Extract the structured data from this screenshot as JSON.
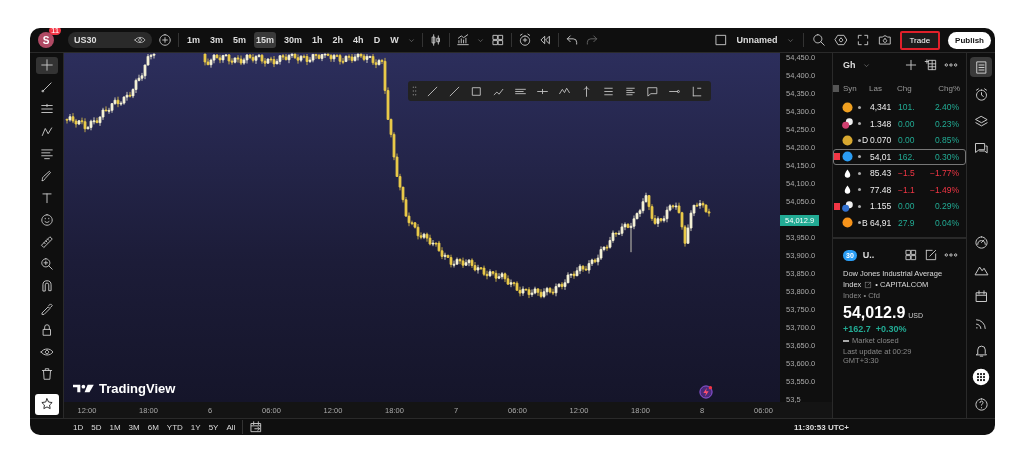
{
  "top_bar": {
    "avatar_letter": "S",
    "notification_count": "11",
    "symbol": "US30",
    "intervals": [
      {
        "label": "1m",
        "selected": false
      },
      {
        "label": "3m",
        "selected": false
      },
      {
        "label": "5m",
        "selected": false
      },
      {
        "label": "15m",
        "selected": true
      },
      {
        "label": "30m",
        "selected": false
      },
      {
        "label": "1h",
        "selected": false
      },
      {
        "label": "2h",
        "selected": false
      },
      {
        "label": "4h",
        "selected": false
      },
      {
        "label": "D",
        "selected": false
      },
      {
        "label": "W",
        "selected": false
      }
    ],
    "layout_name": "Unnamed",
    "trade_button": {
      "label": "Trade",
      "highlighted": true
    },
    "publish_button": "Publish"
  },
  "left_tools": [
    {
      "kind": "crosshair",
      "selected": true
    },
    {
      "kind": "trendline",
      "selected": false
    },
    {
      "kind": "fib",
      "selected": false
    },
    {
      "kind": "pattern",
      "selected": false
    },
    {
      "kind": "forecast",
      "selected": false
    },
    {
      "kind": "brush",
      "selected": false
    },
    {
      "kind": "text",
      "selected": false
    },
    {
      "kind": "emoji",
      "selected": false
    },
    {
      "kind": "ruler",
      "selected": false
    },
    {
      "kind": "zoom",
      "selected": false
    },
    {
      "kind": "magnet",
      "selected": false
    },
    {
      "kind": "lockpen",
      "selected": false
    },
    {
      "kind": "lock",
      "selected": false
    },
    {
      "kind": "eye",
      "selected": false
    },
    {
      "kind": "trash",
      "selected": false
    },
    {
      "kind": "star",
      "selected": false
    }
  ],
  "chart": {
    "logo": "TradingView",
    "current_price": "54,012.9",
    "price_labels_above": [
      "54,450.0",
      "54,400.0",
      "54,350.0",
      "54,300.0",
      "54,250.0",
      "54,200.0",
      "54,150.0",
      "54,100.0",
      "54,050.0"
    ],
    "price_labels_below": [
      "53,950.0",
      "53,900.0",
      "53,850.0",
      "53,800.0",
      "53,750.0",
      "53,700.0",
      "53,650.0",
      "53,600.0",
      "53,550.0",
      "53,5"
    ],
    "time_labels": [
      "12:00",
      "18:00",
      "6",
      "06:00",
      "12:00",
      "18:00",
      "7",
      "06:00",
      "12:00",
      "18:00",
      "8",
      "06:00"
    ]
  },
  "bottom_bar": {
    "ranges": [
      "1D",
      "5D",
      "1M",
      "3M",
      "6M",
      "YTD",
      "1Y",
      "5Y",
      "All"
    ],
    "clock": "11:30:53 UTC+"
  },
  "watchlist": {
    "name": "Gh",
    "columns": [
      "Syn",
      "Las",
      "Chg",
      "Chg%"
    ],
    "rows": [
      {
        "kind": "coin",
        "color": "#f0a020",
        "last": "4,341",
        "change": "101.",
        "change_pct": "2.40%",
        "rising": true,
        "flagged": false,
        "selected": false
      },
      {
        "kind": "pair",
        "color": "#d04070",
        "last": "1.348",
        "change": "0.00",
        "change_pct": "0.23%",
        "rising": true,
        "flagged": false,
        "selected": false
      },
      {
        "kind": "coin",
        "color": "#d8a830",
        "symbol": "D",
        "last": "0.070",
        "change": "0.00",
        "change_pct": "0.85%",
        "rising": true,
        "flagged": false,
        "selected": false
      },
      {
        "kind": "coin",
        "color": "#2a9df4",
        "last": "54,01",
        "change": "162.",
        "change_pct": "0.30%",
        "rising": true,
        "flagged": true,
        "selected": true
      },
      {
        "kind": "drop",
        "color": "#ffffff",
        "last": "85.43",
        "change": "−1.5",
        "change_pct": "−1.77%",
        "rising": false,
        "flagged": false,
        "selected": false
      },
      {
        "kind": "drop",
        "color": "#ffffff",
        "last": "77.48",
        "change": "−1.1",
        "change_pct": "−1.49%",
        "rising": false,
        "flagged": false,
        "selected": false
      },
      {
        "kind": "pair",
        "color": "#3070d0",
        "last": "1.155",
        "change": "0.00",
        "change_pct": "0.29%",
        "rising": true,
        "flagged": true,
        "selected": false
      },
      {
        "kind": "coin",
        "color": "#f7931a",
        "symbol": "B",
        "last": "64,91",
        "change": "27.9",
        "change_pct": "0.04%",
        "rising": true,
        "flagged": false,
        "selected": false
      }
    ]
  },
  "details": {
    "badge": "30",
    "symbol": "U..",
    "name": "Dow Jones Industrial Average",
    "type": "Index",
    "exchange": "• CAPITALCOM",
    "category": "Index • Cfd",
    "price": "54,012.9",
    "currency": "USD",
    "change": "+162.7",
    "change_pct": "+0.30%",
    "status": "Market closed",
    "updated": "Last update at 00:29 GMT+3:30"
  },
  "right_bar": [
    {
      "kind": "watchlist",
      "selected": true
    },
    {
      "kind": "alarm",
      "selected": false
    },
    {
      "kind": "layers",
      "selected": false
    },
    {
      "kind": "chat",
      "selected": false
    },
    {
      "kind": "gauge",
      "selected": false
    },
    {
      "kind": "mountain",
      "selected": false
    },
    {
      "kind": "calendar",
      "selected": false
    },
    {
      "kind": "rss",
      "selected": false
    },
    {
      "kind": "bell",
      "selected": false
    },
    {
      "kind": "apps",
      "selected": false
    },
    {
      "kind": "help",
      "selected": false
    }
  ]
}
